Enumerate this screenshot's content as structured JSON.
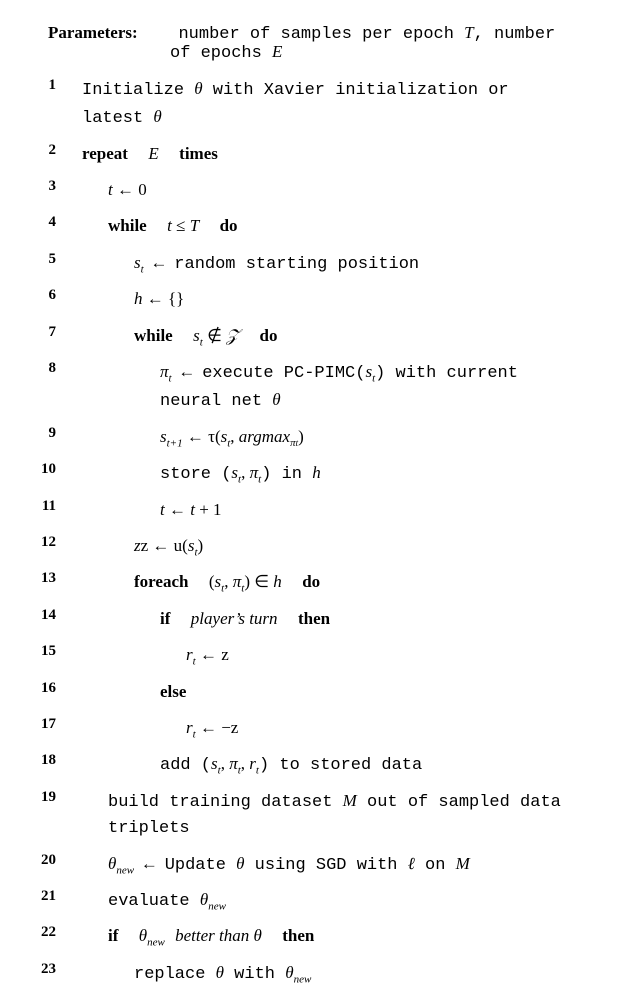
{
  "paramsLabel": "Parameters:",
  "paramsLine1": "number of samples per epoch ",
  "paramsVarT": "T",
  "paramsLine1b": ", number",
  "paramsLine2a": "of epochs ",
  "paramsVarE": "E",
  "l1a": "Initialize ",
  "theta": "θ",
  "l1b": " with Xavier initialization or",
  "l1c": "latest ",
  "kw_repeat": "repeat",
  "kw_times": "times",
  "kw_while": "while",
  "kw_do": "do",
  "kw_foreach": "foreach",
  "kw_if": "if",
  "kw_then": "then",
  "kw_else": "else",
  "l3": "t ← 0",
  "l4_a": "t ≤ T",
  "l5_a": "s",
  "l5_b": " ← random starting position",
  "l6": "h ← {}",
  "l7_a": " ∉ ",
  "calZ": "𝒵",
  "l8_a": "π",
  "l8_b": " ← execute PC-PIMC(",
  "l8_c": ") with current",
  "l8_d": "neural net ",
  "l9_a": " ← τ(",
  "l9_b": ", ",
  "argmax": "argmax",
  "l9_c": ")",
  "l10_a": "store (",
  "l10_b": ") in ",
  "hvar": "h",
  "l11": "t ← t + 1",
  "l12_a": "z ← u(",
  "l12_b": ")",
  "l13_a": "(",
  "l13_b": ") ∈ ",
  "l14_txt": "player’s turn",
  "l15_a": "r",
  "l15_b": " ← z",
  "l17_b": " ← −z",
  "l18_a": "add (",
  "l18_b": ") to stored data",
  "l19_a": "build training dataset ",
  "Mvar": "M",
  "l19_b": " out of sampled data",
  "l19_c": "triplets",
  "l20_a": " ← Update ",
  "l20_b": " using SGD with ",
  "ell": "ℓ",
  "l20_c": " on ",
  "newsub": "new",
  "l21_a": "evaluate ",
  "l22_a": " better than ",
  "l23_a": "replace ",
  "l23_b": " with ",
  "lnum": {
    "1": "1",
    "2": "2",
    "3": "3",
    "4": "4",
    "5": "5",
    "6": "6",
    "7": "7",
    "8": "8",
    "9": "9",
    "10": "10",
    "11": "11",
    "12": "12",
    "13": "13",
    "14": "14",
    "15": "15",
    "16": "16",
    "17": "17",
    "18": "18",
    "19": "19",
    "20": "20",
    "21": "21",
    "22": "22",
    "23": "23"
  }
}
